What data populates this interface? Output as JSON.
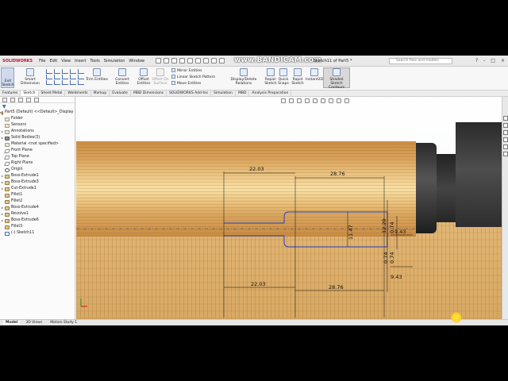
{
  "app": {
    "logo": "SOLIDWORKS",
    "menu": [
      "File",
      "Edit",
      "View",
      "Insert",
      "Tools",
      "Simulation",
      "Window"
    ],
    "watermark": "www.BANDICAM.com",
    "document_title": "Sketch11 of Part5 *",
    "search_placeholder": "Search files and models",
    "window_controls": [
      "?",
      "-",
      "□",
      "×"
    ]
  },
  "commands": {
    "exit_sketch": "Exit Sketch",
    "smart_dimension": "Smart Dimension",
    "trim_entities": "Trim Entities",
    "convert_entities": "Convert Entities",
    "offset_entities": "Offset Entities",
    "offset_on_surface": "Offset On Surface",
    "mirror_entities": "Mirror Entities",
    "linear_sketch_pattern": "Linear Sketch Pattern",
    "move_entities": "Move Entities",
    "display_delete_relations": "Display/Delete Relations",
    "repair_sketch": "Repair Sketch",
    "quick_snaps": "Quick Snaps",
    "rapid_sketch": "Rapid Sketch",
    "instant2d": "Instant2D",
    "shaded_sketch_contours": "Shaded Sketch Contours"
  },
  "tabs": [
    "Features",
    "Sketch",
    "Sheet Metal",
    "Weldments",
    "Markup",
    "Evaluate",
    "MBD Dimensions",
    "SOLIDWORKS Add-Ins",
    "Simulation",
    "MBD",
    "Analysis Preparation"
  ],
  "active_tab": "Sketch",
  "tree": {
    "root": "Part5 (Default) <<Default>_Display S",
    "items": [
      {
        "label": "Folder",
        "type": "folder",
        "expandable": false
      },
      {
        "label": "Sensors",
        "type": "folder",
        "expandable": false
      },
      {
        "label": "Annotations",
        "type": "folder",
        "expandable": true
      },
      {
        "label": "Solid Bodies(3)",
        "type": "solid",
        "expandable": true
      },
      {
        "label": "Material <not specified>",
        "type": "folder",
        "expandable": false
      },
      {
        "label": "Front Plane",
        "type": "plane",
        "expandable": false
      },
      {
        "label": "Top Plane",
        "type": "plane",
        "expandable": false
      },
      {
        "label": "Right Plane",
        "type": "plane",
        "expandable": false
      },
      {
        "label": "Origin",
        "type": "origin",
        "expandable": false
      },
      {
        "label": "Boss-Extrude1",
        "type": "feat",
        "expandable": true
      },
      {
        "label": "Boss-Extrude3",
        "type": "feat",
        "expandable": true
      },
      {
        "label": "Cut-Extrude1",
        "type": "feat",
        "expandable": true
      },
      {
        "label": "Fillet1",
        "type": "feat",
        "expandable": false
      },
      {
        "label": "Fillet2",
        "type": "feat",
        "expandable": false
      },
      {
        "label": "Boss-Extrude4",
        "type": "feat",
        "expandable": true
      },
      {
        "label": "Revolve1",
        "type": "feat",
        "expandable": true
      },
      {
        "label": "Boss-Extrude6",
        "type": "feat",
        "expandable": true
      },
      {
        "label": "Fillet3",
        "type": "feat",
        "expandable": false
      },
      {
        "label": "(-) Sketch11",
        "type": "sketch",
        "expandable": false
      }
    ]
  },
  "dimensions": {
    "top_left": "22.03",
    "top_mid": "28.76",
    "right_upper": "9.43",
    "vert_a": "12.20",
    "vert_b": "0.74",
    "center_height": "11.47",
    "vert_c": "0.74",
    "vert_d": "0.74",
    "bottom_left": "22.03",
    "bottom_mid": "28.76",
    "bottom_right": "9.43"
  },
  "bottom_tabs": [
    "Model",
    "3D Views",
    "Motion Study 1"
  ],
  "active_bottom_tab": "Model",
  "colors": {
    "sketch_line": "#2c3fbf",
    "dimension_line": "#111111",
    "brand_red": "#c8102e"
  }
}
